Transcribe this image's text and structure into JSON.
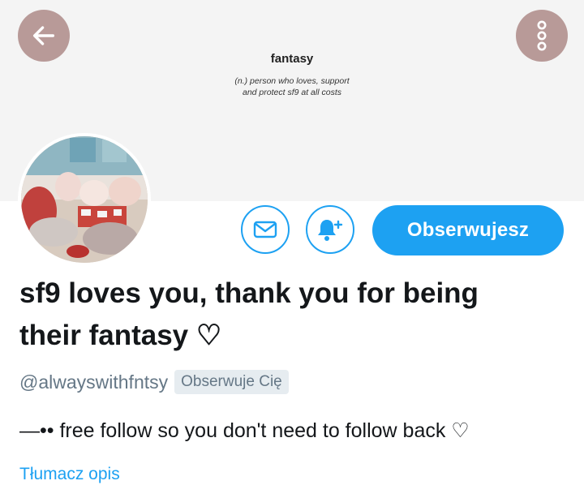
{
  "header": {
    "banner_title": "fantasy",
    "banner_subtitle_line1": "(n.) person who loves, support",
    "banner_subtitle_line2": "and protect sf9 at all costs",
    "back_icon": "arrow-left-icon",
    "more_icon": "more-vertical-icon"
  },
  "actions": {
    "message_icon": "envelope-icon",
    "notifications_icon": "bell-plus-icon",
    "follow_label": "Obserwujesz"
  },
  "profile": {
    "name_line1": "sf9 loves you, thank you for being",
    "name_line2": "their fantasy ♡",
    "handle": "@alwayswithfntsy",
    "follows_you_badge": "Obserwuje Cię",
    "bio": "—•• free follow so you don't need to follow back ♡",
    "translate_label": "Tłumacz opis"
  },
  "colors": {
    "accent": "#1da1f2",
    "header_button": "#b89a98",
    "secondary_text": "#657786",
    "primary_text": "#14171a"
  }
}
